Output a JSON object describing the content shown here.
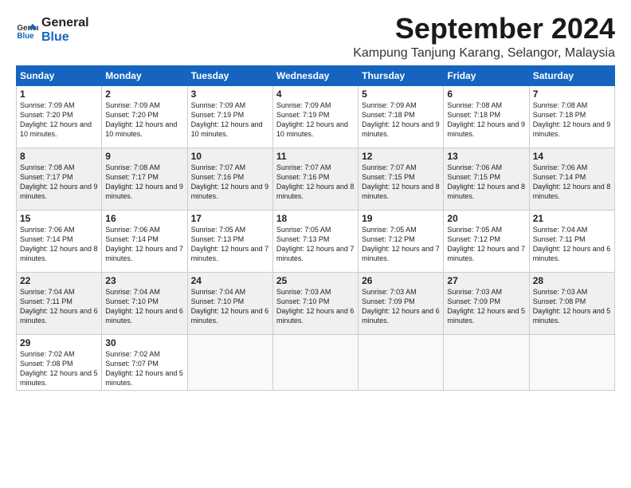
{
  "logo": {
    "line1": "General",
    "line2": "Blue"
  },
  "title": "September 2024",
  "location": "Kampung Tanjung Karang, Selangor, Malaysia",
  "days_of_week": [
    "Sunday",
    "Monday",
    "Tuesday",
    "Wednesday",
    "Thursday",
    "Friday",
    "Saturday"
  ],
  "weeks": [
    [
      {
        "day": "1",
        "sunrise": "Sunrise: 7:09 AM",
        "sunset": "Sunset: 7:20 PM",
        "daylight": "Daylight: 12 hours and 10 minutes."
      },
      {
        "day": "2",
        "sunrise": "Sunrise: 7:09 AM",
        "sunset": "Sunset: 7:20 PM",
        "daylight": "Daylight: 12 hours and 10 minutes."
      },
      {
        "day": "3",
        "sunrise": "Sunrise: 7:09 AM",
        "sunset": "Sunset: 7:19 PM",
        "daylight": "Daylight: 12 hours and 10 minutes."
      },
      {
        "day": "4",
        "sunrise": "Sunrise: 7:09 AM",
        "sunset": "Sunset: 7:19 PM",
        "daylight": "Daylight: 12 hours and 10 minutes."
      },
      {
        "day": "5",
        "sunrise": "Sunrise: 7:09 AM",
        "sunset": "Sunset: 7:18 PM",
        "daylight": "Daylight: 12 hours and 9 minutes."
      },
      {
        "day": "6",
        "sunrise": "Sunrise: 7:08 AM",
        "sunset": "Sunset: 7:18 PM",
        "daylight": "Daylight: 12 hours and 9 minutes."
      },
      {
        "day": "7",
        "sunrise": "Sunrise: 7:08 AM",
        "sunset": "Sunset: 7:18 PM",
        "daylight": "Daylight: 12 hours and 9 minutes."
      }
    ],
    [
      {
        "day": "8",
        "sunrise": "Sunrise: 7:08 AM",
        "sunset": "Sunset: 7:17 PM",
        "daylight": "Daylight: 12 hours and 9 minutes."
      },
      {
        "day": "9",
        "sunrise": "Sunrise: 7:08 AM",
        "sunset": "Sunset: 7:17 PM",
        "daylight": "Daylight: 12 hours and 9 minutes."
      },
      {
        "day": "10",
        "sunrise": "Sunrise: 7:07 AM",
        "sunset": "Sunset: 7:16 PM",
        "daylight": "Daylight: 12 hours and 9 minutes."
      },
      {
        "day": "11",
        "sunrise": "Sunrise: 7:07 AM",
        "sunset": "Sunset: 7:16 PM",
        "daylight": "Daylight: 12 hours and 8 minutes."
      },
      {
        "day": "12",
        "sunrise": "Sunrise: 7:07 AM",
        "sunset": "Sunset: 7:15 PM",
        "daylight": "Daylight: 12 hours and 8 minutes."
      },
      {
        "day": "13",
        "sunrise": "Sunrise: 7:06 AM",
        "sunset": "Sunset: 7:15 PM",
        "daylight": "Daylight: 12 hours and 8 minutes."
      },
      {
        "day": "14",
        "sunrise": "Sunrise: 7:06 AM",
        "sunset": "Sunset: 7:14 PM",
        "daylight": "Daylight: 12 hours and 8 minutes."
      }
    ],
    [
      {
        "day": "15",
        "sunrise": "Sunrise: 7:06 AM",
        "sunset": "Sunset: 7:14 PM",
        "daylight": "Daylight: 12 hours and 8 minutes."
      },
      {
        "day": "16",
        "sunrise": "Sunrise: 7:06 AM",
        "sunset": "Sunset: 7:14 PM",
        "daylight": "Daylight: 12 hours and 7 minutes."
      },
      {
        "day": "17",
        "sunrise": "Sunrise: 7:05 AM",
        "sunset": "Sunset: 7:13 PM",
        "daylight": "Daylight: 12 hours and 7 minutes."
      },
      {
        "day": "18",
        "sunrise": "Sunrise: 7:05 AM",
        "sunset": "Sunset: 7:13 PM",
        "daylight": "Daylight: 12 hours and 7 minutes."
      },
      {
        "day": "19",
        "sunrise": "Sunrise: 7:05 AM",
        "sunset": "Sunset: 7:12 PM",
        "daylight": "Daylight: 12 hours and 7 minutes."
      },
      {
        "day": "20",
        "sunrise": "Sunrise: 7:05 AM",
        "sunset": "Sunset: 7:12 PM",
        "daylight": "Daylight: 12 hours and 7 minutes."
      },
      {
        "day": "21",
        "sunrise": "Sunrise: 7:04 AM",
        "sunset": "Sunset: 7:11 PM",
        "daylight": "Daylight: 12 hours and 6 minutes."
      }
    ],
    [
      {
        "day": "22",
        "sunrise": "Sunrise: 7:04 AM",
        "sunset": "Sunset: 7:11 PM",
        "daylight": "Daylight: 12 hours and 6 minutes."
      },
      {
        "day": "23",
        "sunrise": "Sunrise: 7:04 AM",
        "sunset": "Sunset: 7:10 PM",
        "daylight": "Daylight: 12 hours and 6 minutes."
      },
      {
        "day": "24",
        "sunrise": "Sunrise: 7:04 AM",
        "sunset": "Sunset: 7:10 PM",
        "daylight": "Daylight: 12 hours and 6 minutes."
      },
      {
        "day": "25",
        "sunrise": "Sunrise: 7:03 AM",
        "sunset": "Sunset: 7:10 PM",
        "daylight": "Daylight: 12 hours and 6 minutes."
      },
      {
        "day": "26",
        "sunrise": "Sunrise: 7:03 AM",
        "sunset": "Sunset: 7:09 PM",
        "daylight": "Daylight: 12 hours and 6 minutes."
      },
      {
        "day": "27",
        "sunrise": "Sunrise: 7:03 AM",
        "sunset": "Sunset: 7:09 PM",
        "daylight": "Daylight: 12 hours and 5 minutes."
      },
      {
        "day": "28",
        "sunrise": "Sunrise: 7:03 AM",
        "sunset": "Sunset: 7:08 PM",
        "daylight": "Daylight: 12 hours and 5 minutes."
      }
    ],
    [
      {
        "day": "29",
        "sunrise": "Sunrise: 7:02 AM",
        "sunset": "Sunset: 7:08 PM",
        "daylight": "Daylight: 12 hours and 5 minutes."
      },
      {
        "day": "30",
        "sunrise": "Sunrise: 7:02 AM",
        "sunset": "Sunset: 7:07 PM",
        "daylight": "Daylight: 12 hours and 5 minutes."
      },
      null,
      null,
      null,
      null,
      null
    ]
  ]
}
